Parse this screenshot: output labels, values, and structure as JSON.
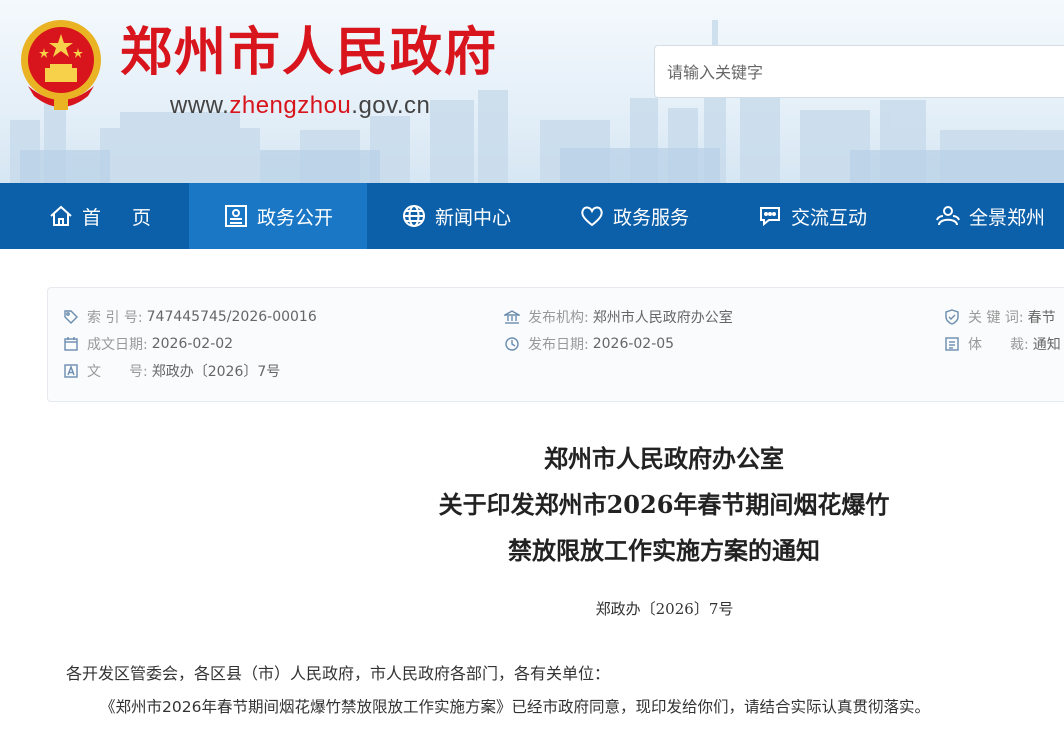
{
  "header": {
    "site_title": "郑州市人民政府",
    "url_prefix": "www.",
    "url_highlight": "zhengzhou",
    "url_suffix": ".gov.cn",
    "search_placeholder": "请输入关键字"
  },
  "nav": {
    "items": [
      {
        "label": "首　页",
        "icon": "home-icon"
      },
      {
        "label": "政务公开",
        "icon": "document-board-icon",
        "active": true
      },
      {
        "label": "新闻中心",
        "icon": "globe-icon"
      },
      {
        "label": "政务服务",
        "icon": "heart-icon"
      },
      {
        "label": "交流互动",
        "icon": "chat-icon"
      },
      {
        "label": "全景郑州",
        "icon": "people-icon"
      }
    ]
  },
  "meta": {
    "index_label": "索 引 号:",
    "index_value": "747445745/2026-00016",
    "created_label": "成文日期:",
    "created_value": "2026-02-02",
    "docno_label": "文　　号:",
    "docno_value": "郑政办〔2026〕7号",
    "publisher_label": "发布机构:",
    "publisher_value": "郑州市人民政府办公室",
    "pubdate_label": "发布日期:",
    "pubdate_value": "2026-02-05",
    "keyword_label": "关 键 词:",
    "keyword_value": "春节",
    "genre_label": "体　　裁:",
    "genre_value": "通知"
  },
  "article": {
    "title_lines": [
      "郑州市人民政府办公室",
      "关于印发郑州市2026年春节期间烟花爆竹",
      "禁放限放工作实施方案的通知"
    ],
    "doc_number": "郑政办〔2026〕7号",
    "salutation": "各开发区管委会，各区县（市）人民政府，市人民政府各部门，各有关单位：",
    "body": "《郑州市2026年春节期间烟花爆竹禁放限放工作实施方案》已经市政府同意，现印发给你们，请结合实际认真贯彻落实。"
  },
  "colors": {
    "brand_red": "#d8141c",
    "nav_blue": "#0c5fa9",
    "nav_active": "#1a77c6"
  }
}
